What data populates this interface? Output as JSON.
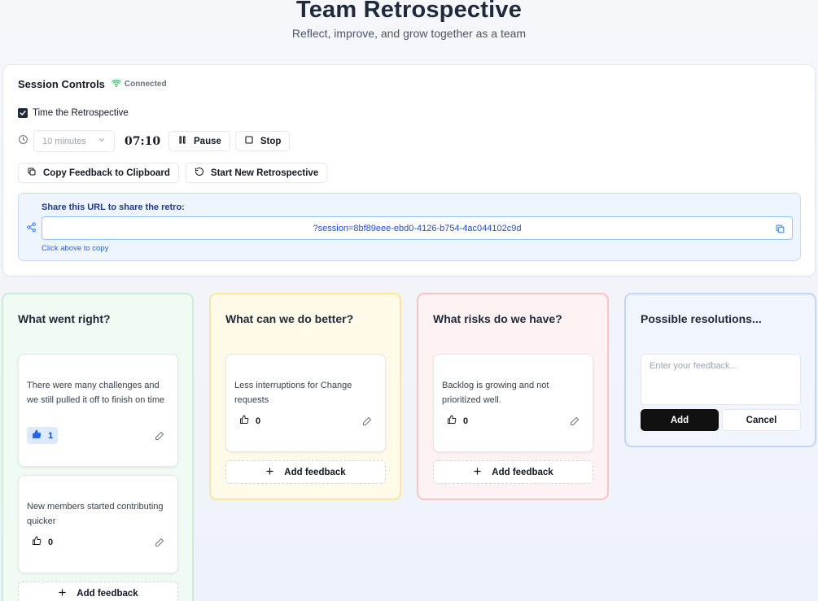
{
  "header": {
    "title": "Team Retrospective",
    "subtitle": "Reflect, improve, and grow together as a team"
  },
  "session": {
    "title": "Session Controls",
    "status": "Connected",
    "timer_checkbox_label": "Time the Retrospective",
    "timer_checked": true,
    "duration_select": "10 minutes",
    "time_remaining": "07:10",
    "pause_label": "Pause",
    "stop_label": "Stop",
    "copy_label": "Copy Feedback to Clipboard",
    "new_retro_label": "Start New Retrospective",
    "share_label": "Share this URL to share the retro:",
    "share_url": "?session=8bf89eee-ebd0-4126-b754-4ac044102c9d",
    "share_hint": "Click above to copy"
  },
  "columns": [
    {
      "title": "What went right?",
      "color": "#f0fbf3",
      "cards": [
        {
          "text": "There were many challenges and we still pulled it off to finish on time",
          "votes": "1",
          "voted": true
        },
        {
          "text": "New members started contributing quicker",
          "votes": "0",
          "voted": false
        }
      ],
      "add_label": "Add feedback"
    },
    {
      "title": "What can we do better?",
      "color": "#fffbe8",
      "cards": [
        {
          "text": "Less interruptions for Change requests",
          "votes": "0",
          "voted": false
        }
      ],
      "add_label": "Add feedback"
    },
    {
      "title": "What risks do we have?",
      "color": "#fff2f2",
      "cards": [
        {
          "text": "Backlog is growing and not prioritized well.",
          "votes": "0",
          "voted": false
        }
      ],
      "add_label": "Add feedback"
    },
    {
      "title": "Possible resolutions...",
      "color": "#f0f5ff",
      "input_placeholder": "Enter your feedback...",
      "add_submit_label": "Add",
      "cancel_label": "Cancel"
    }
  ],
  "icons": {
    "wifi": "wifi-icon",
    "clock": "clock-icon",
    "pause": "pause-icon",
    "stop": "stop-icon",
    "copy": "copy-icon",
    "refresh": "refresh-icon",
    "share": "share-icon",
    "thumb": "thumbs-up-icon",
    "edit": "pencil-icon",
    "plus": "plus-icon"
  }
}
